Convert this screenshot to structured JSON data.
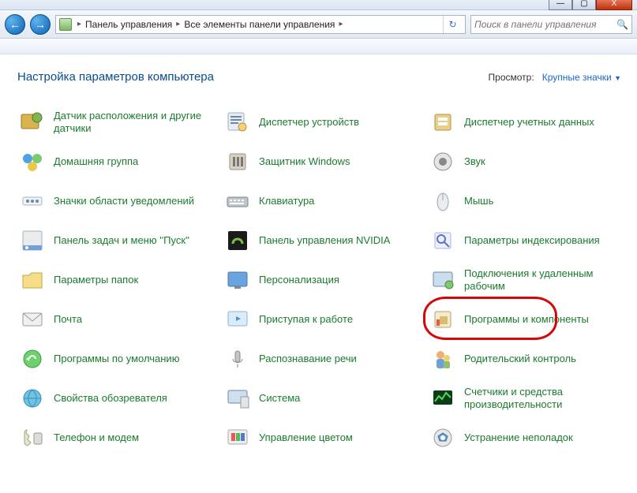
{
  "titlebar": {
    "minimize": "—",
    "maximize": "▢",
    "close": "X"
  },
  "nav": {
    "back_glyph": "←",
    "forward_glyph": "→",
    "crumb1": "Панель управления",
    "crumb2": "Все элементы панели управления",
    "refresh_glyph": "↻",
    "search_placeholder": "Поиск в панели управления"
  },
  "heading": "Настройка параметров компьютера",
  "view": {
    "label": "Просмотр:",
    "value": "Крупные значки"
  },
  "items": [
    {
      "label": "Датчик расположения и другие датчики",
      "icon": "sensor"
    },
    {
      "label": "Диспетчер устройств",
      "icon": "devicemgr"
    },
    {
      "label": "Диспетчер учетных данных",
      "icon": "credentials"
    },
    {
      "label": "Домашняя группа",
      "icon": "homegroup"
    },
    {
      "label": "Защитник Windows",
      "icon": "defender"
    },
    {
      "label": "Звук",
      "icon": "sound"
    },
    {
      "label": "Значки области уведомлений",
      "icon": "trayicons"
    },
    {
      "label": "Клавиатура",
      "icon": "keyboard"
    },
    {
      "label": "Мышь",
      "icon": "mouse"
    },
    {
      "label": "Панель задач и меню ''Пуск''",
      "icon": "taskbar"
    },
    {
      "label": "Панель управления NVIDIA",
      "icon": "nvidia"
    },
    {
      "label": "Параметры индексирования",
      "icon": "indexing"
    },
    {
      "label": "Параметры папок",
      "icon": "folder"
    },
    {
      "label": "Персонализация",
      "icon": "personalize"
    },
    {
      "label": "Подключения к удаленным рабочим",
      "icon": "remote"
    },
    {
      "label": "Почта",
      "icon": "mail"
    },
    {
      "label": "Приступая к работе",
      "icon": "gettingstarted"
    },
    {
      "label": "Программы и компоненты",
      "icon": "programs",
      "highlight": true
    },
    {
      "label": "Программы по умолчанию",
      "icon": "default"
    },
    {
      "label": "Распознавание речи",
      "icon": "speech"
    },
    {
      "label": "Родительский контроль",
      "icon": "parental"
    },
    {
      "label": "Свойства обозревателя",
      "icon": "inetopt"
    },
    {
      "label": "Система",
      "icon": "system"
    },
    {
      "label": "Счетчики и средства производительности",
      "icon": "perf"
    },
    {
      "label": "Телефон и модем",
      "icon": "phone"
    },
    {
      "label": "Управление цветом",
      "icon": "color"
    },
    {
      "label": "Устранение неполадок",
      "icon": "troubleshoot"
    }
  ]
}
